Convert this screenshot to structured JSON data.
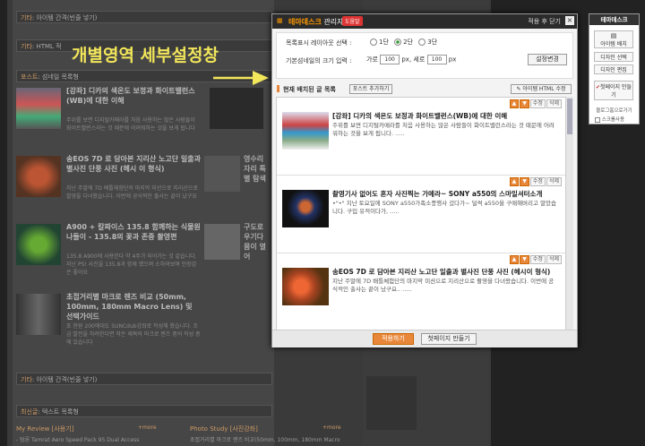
{
  "annotation": {
    "text": "개별영역 세부설정창"
  },
  "background": {
    "bar_top": {
      "prefix": "기타",
      "text": ": 아이템 간격(빈줄 넣기)"
    },
    "bar_html": {
      "prefix": "기타",
      "text": ": HTML 적"
    },
    "section_title": {
      "prefix": "포스트",
      "text": ": 섬네일 목록형"
    },
    "posts": [
      {
        "title": "[강좌] 디카의 색온도 보정과 화이트밸런스(WB)에 대한 이해",
        "desc": "주위를 보면 디지털카메라를 처음 사용하는 많은 사람들이 화이트밸런스라는 것 때문에 어려워하는 것을 보게 됩니다",
        "right": ""
      },
      {
        "title": "송EOS 7D 로 담아본 지리산 노고단 일출과 별사진 단풍 사진 (헤시 이 형식)",
        "desc": "지난 주말에 7D 배틀체험단의 마지막 미션으로 지리산으로 촬영을 다녀왔습니다. 이번에 공식적인 출사는 끝이 났구요",
        "right": "영수리 자리 특별 탐색"
      },
      {
        "title": "A900 + 칼짜이스 135.8 함께하는 식물원 나들이 - 135.8의 꽃과 존중 촬영편",
        "desc": "135.8 A900에 사용한다 약 4주가 되어가는 것 같습니다. 지난 PS! 사진을 135.8과 함께 했으며 소하여보며 인장감은 좋아요",
        "right": "구도로 우기다 몸이 열어"
      },
      {
        "title": "초접거리별 마크로 렌즈 비교 (50mm, 100mm, 180mm Macro Lens) 및 선택가이드",
        "desc": "초 현원 200에대도 SUNCdub강좌로 작성해 왔습니다. 조금 발전을 하려한다면 작은 제목의 마크로 렌즈 중의 작성 중에 있습니다",
        "right": ""
      }
    ],
    "bar_bottom": {
      "prefix": "기타",
      "text": ": 아이템 간격(빈줄 넣기)"
    },
    "section2_title": {
      "prefix": "최신글",
      "text": ": 텍스트 목록형"
    },
    "col1": {
      "title": "My Review [사용기]",
      "more": "+more",
      "item": "- 탐론 Tamrat Aero Speed Pack 95 Dual Access"
    },
    "col2": {
      "title": "Photo Study [사진강좌]",
      "more": "+more",
      "item": "초접거리별 마크로 렌즈 비교(50mm, 100mm, 180mm Macro"
    }
  },
  "dialog": {
    "title": "테마데스크",
    "title_suffix": "관리자",
    "help": "도움말",
    "apply_note": "적용 후 닫기",
    "close": "×",
    "settings": {
      "layout_label": "목록표시 레이아웃 선택 :",
      "layout_options": [
        "1단",
        "2단",
        "3단"
      ],
      "layout_selected": 1,
      "size_label": "기본섬네일의 크기 입력 :",
      "width_label": "가로",
      "width_value": "100",
      "height_label": "px, 세로",
      "height_value": "100",
      "unit": "px",
      "change_button": "설정변경"
    },
    "list_header": {
      "label": "현재 배치된 글 목록",
      "add_button": "포스트 추가하기",
      "html_button": "아이템 HTML 수정"
    },
    "items": [
      {
        "title": "[강좌] 디카의 색온도 보정과 화이트밸런스(WB)에 대한 이해",
        "desc": "주위를 보면 디지털카메라를 처음 사용하는 많은 사람들이 화이트밸런스라는 것 때문에 어려워하는 것을 보게 됩니다. ....."
      },
      {
        "title": "촬영기사 없어도 혼자 사진찍는 가메라~ SONY a550의 스마일셔터소개",
        "desc": "•\"•\" 지난 토요일에 SONY a550가족소풍행사 갔다가~ 덜썩 a550을 구매해버리고 말았습니다. 구입 유적이다가, ....."
      },
      {
        "title": "송EOS 7D 로 담아본 지리산 노고단 일출과 별사진 단풍 사진 (헤시이 형식)",
        "desc": "지난 주말에 7D 배틀체험단의 마지막 미션으로 지리산으로 촬영을 다녀왔습니다. 이번에 공식적인 출사는 끝이 났구요.. ....."
      }
    ],
    "item_controls": {
      "up": "▲",
      "down": "▼",
      "edit": "수정",
      "delete": "삭제"
    },
    "footer": {
      "apply": "적용하기",
      "make_page": "첫페이지 만들기"
    }
  },
  "right_panel": {
    "title": "테마데스크",
    "buttons": [
      "아이템 배치",
      "디자인 선택",
      "디자인 편집"
    ],
    "first_page": "첫페이지 만들기",
    "blog_home": "블로그홈으로가기",
    "scroll_label": "스크롤사용"
  },
  "colors": {
    "accent": "#e8873a",
    "annotation": "#f2e65a"
  }
}
